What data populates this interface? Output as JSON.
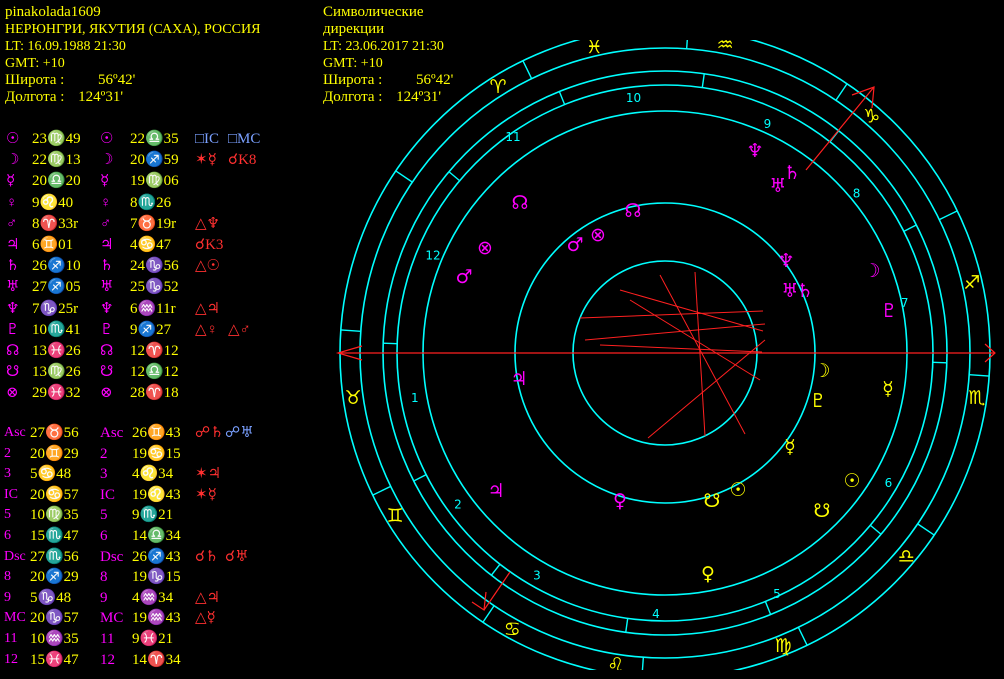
{
  "natal": {
    "name": "pinakolada1609",
    "place": "НЕРЮНГРИ, ЯКУТИЯ (САХА), РОССИЯ",
    "lt": "LT: 16.09.1988  21:30",
    "gmt": "GMT: +10",
    "lat_label": "Широта :",
    "lat_value": "56º42'",
    "lon_label": "Долгота :",
    "lon_value": "124º31'"
  },
  "directions": {
    "title_line1": "Символические",
    "title_line2": "дирекции",
    "lt": "LT: 23.06.2017  21:30",
    "gmt": "GMT: +10",
    "lat_label": "Широта :",
    "lat_value": "56º42'",
    "lon_label": "Долгота :",
    "lon_value": "124º31'"
  },
  "planets": [
    {
      "glyph": "☉",
      "natal": "23♍49",
      "dir": "22♎35",
      "aspects": [
        {
          "g": "□IC",
          "c": "b"
        },
        {
          "g": "□MC",
          "c": "b"
        }
      ]
    },
    {
      "glyph": "☽",
      "natal": "22♍13",
      "dir": "20♐59",
      "aspects": [
        {
          "g": "✶☿",
          "c": "r"
        },
        {
          "g": "☌K8",
          "c": "r"
        }
      ]
    },
    {
      "glyph": "☿",
      "natal": "20♎20",
      "dir": "19♍06",
      "aspects": []
    },
    {
      "glyph": "♀",
      "natal": "9♌40",
      "dir": "8♏26",
      "aspects": []
    },
    {
      "glyph": "♂",
      "natal": "8♈33r",
      "dir": "7♉19r",
      "aspects": [
        {
          "g": "△♆",
          "c": "r"
        }
      ]
    },
    {
      "glyph": "♃",
      "natal": "6♊01",
      "dir": "4♋47",
      "aspects": [
        {
          "g": "☌K3",
          "c": "r"
        }
      ]
    },
    {
      "glyph": "♄",
      "natal": "26♐10",
      "dir": "24♑56",
      "aspects": [
        {
          "g": "△☉",
          "c": "r"
        }
      ]
    },
    {
      "glyph": "♅",
      "natal": "27♐05",
      "dir": "25♑52",
      "aspects": []
    },
    {
      "glyph": "♆",
      "natal": "7♑25r",
      "dir": "6♒11r",
      "aspects": [
        {
          "g": "△♃",
          "c": "r"
        }
      ]
    },
    {
      "glyph": "♇",
      "natal": "10♏41",
      "dir": "9♐27",
      "aspects": [
        {
          "g": "△♀",
          "c": "r"
        },
        {
          "g": "△♂",
          "c": "r"
        }
      ]
    },
    {
      "glyph": "☊",
      "natal": "13♓26",
      "dir": "12♈12",
      "aspects": []
    },
    {
      "glyph": "☋",
      "natal": "13♍26",
      "dir": "12♎12",
      "aspects": []
    },
    {
      "glyph": "⊗",
      "natal": "29♓32",
      "dir": "28♈18",
      "aspects": []
    }
  ],
  "houses": [
    {
      "label": "Asc",
      "natal": "27♉56",
      "dir_label": "Asc",
      "dir": "26♊43",
      "aspects": [
        {
          "g": "☍♄",
          "c": "r"
        },
        {
          "g": "☍♅",
          "c": "b"
        }
      ]
    },
    {
      "label": "2",
      "natal": "20♊29",
      "dir_label": "2",
      "dir": "19♋15",
      "aspects": []
    },
    {
      "label": "3",
      "natal": "5♋48",
      "dir_label": "3",
      "dir": "4♌34",
      "aspects": [
        {
          "g": "✶♃",
          "c": "r"
        }
      ]
    },
    {
      "label": "IC",
      "natal": "20♋57",
      "dir_label": "IC",
      "dir": "19♌43",
      "aspects": [
        {
          "g": "✶☿",
          "c": "r"
        }
      ]
    },
    {
      "label": "5",
      "natal": "10♍35",
      "dir_label": "5",
      "dir": "9♏21",
      "aspects": []
    },
    {
      "label": "6",
      "natal": "15♏47",
      "dir_label": "6",
      "dir": "14♎34",
      "aspects": []
    },
    {
      "label": "Dsc",
      "natal": "27♏56",
      "dir_label": "Dsc",
      "dir": "26♐43",
      "aspects": [
        {
          "g": "☌♄",
          "c": "r"
        },
        {
          "g": "☌♅",
          "c": "r"
        }
      ]
    },
    {
      "label": "8",
      "natal": "20♐29",
      "dir_label": "8",
      "dir": "19♑15",
      "aspects": []
    },
    {
      "label": "9",
      "natal": "5♑48",
      "dir_label": "9",
      "dir": "4♒34",
      "aspects": [
        {
          "g": "△♃",
          "c": "r"
        }
      ]
    },
    {
      "label": "MC",
      "natal": "20♑57",
      "dir_label": "MC",
      "dir": "19♒43",
      "aspects": [
        {
          "g": "△☿",
          "c": "r"
        }
      ]
    },
    {
      "label": "11",
      "natal": "10♒35",
      "dir_label": "11",
      "dir": "9♓21",
      "aspects": []
    },
    {
      "label": "12",
      "natal": "15♓47",
      "dir_label": "12",
      "dir": "14♈34",
      "aspects": []
    }
  ],
  "wheel": {
    "zodiac": [
      {
        "sign": "♓",
        "name": "pisces",
        "color": "#ffff00"
      },
      {
        "sign": "♒",
        "name": "aquarius",
        "color": "#ffff00"
      },
      {
        "sign": "♑",
        "name": "capricorn",
        "color": "#ffff00"
      },
      {
        "sign": "♐",
        "name": "sagittarius",
        "color": "#ffff00"
      },
      {
        "sign": "♏",
        "name": "scorpio",
        "color": "#ffff00"
      },
      {
        "sign": "♎",
        "name": "libra",
        "color": "#ffff00"
      },
      {
        "sign": "♍",
        "name": "virgo",
        "color": "#ffff00"
      },
      {
        "sign": "♌",
        "name": "leo",
        "color": "#ffff00"
      },
      {
        "sign": "♋",
        "name": "cancer",
        "color": "#ffff00"
      },
      {
        "sign": "♊",
        "name": "gemini",
        "color": "#ffff00"
      },
      {
        "sign": "♉",
        "name": "taurus",
        "color": "#ffff00"
      },
      {
        "sign": "♈",
        "name": "aries",
        "color": "#ffff00"
      }
    ],
    "house_numbers": [
      "1",
      "2",
      "3",
      "4",
      "5",
      "6",
      "7",
      "8",
      "9",
      "10",
      "11",
      "12"
    ],
    "colors": {
      "ring": "#00ffff",
      "axis": "#ff2020",
      "magenta": "#ff00ff",
      "yellow": "#ffff00"
    }
  }
}
